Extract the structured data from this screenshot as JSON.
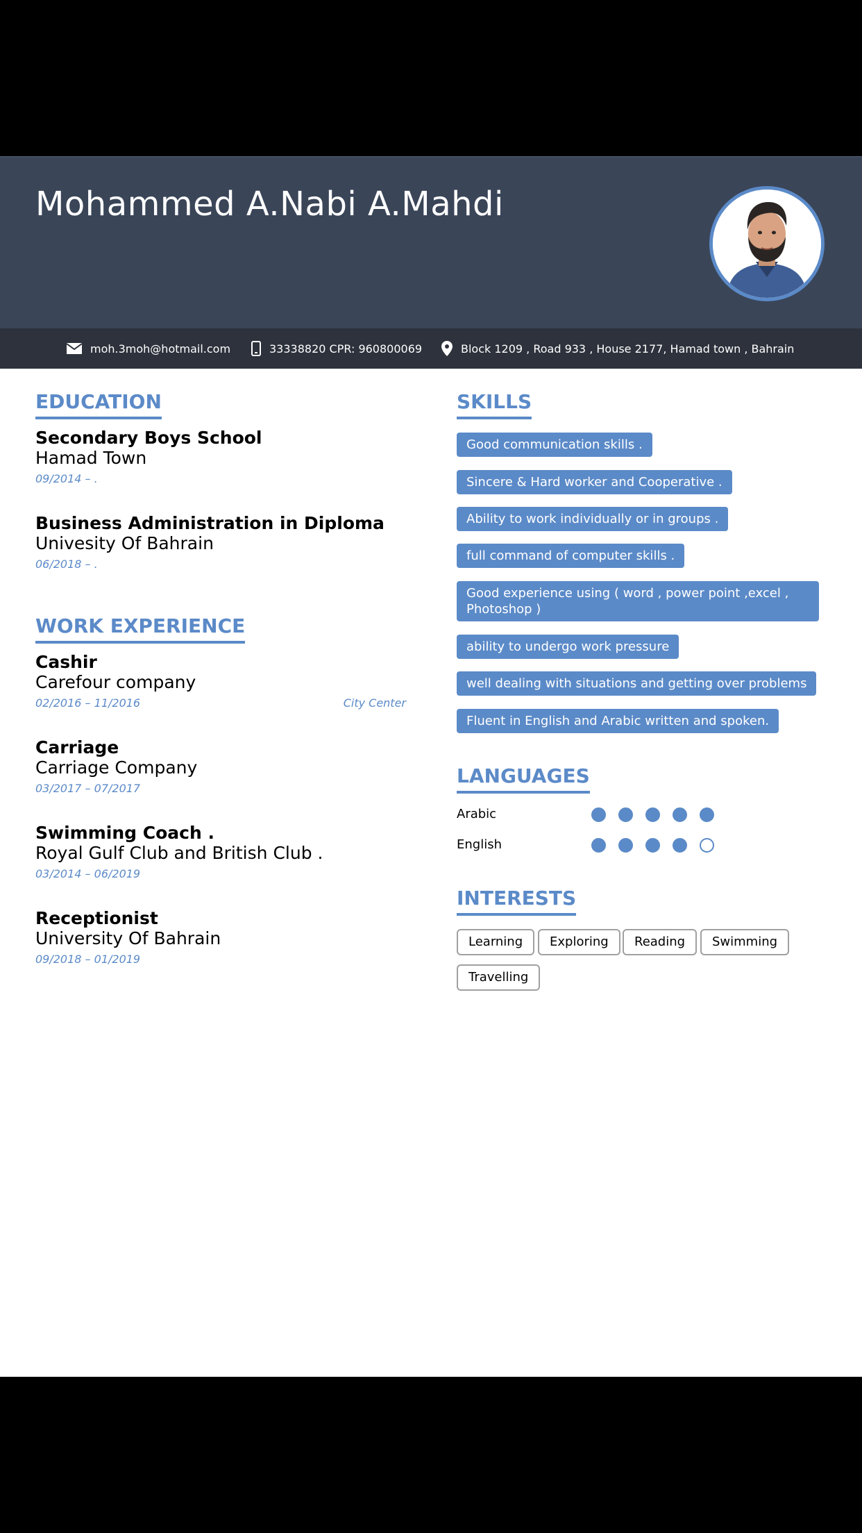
{
  "header": {
    "name": "Mohammed A.Nabi A.Mahdi",
    "accent_color": "#5b8ac8",
    "header_color": "#3a4558"
  },
  "contact": {
    "email": "moh.3moh@hotmail.com",
    "phone": "33338820 CPR: 960800069",
    "address": "Block 1209 , Road 933 , House 2177, Hamad town , Bahrain",
    "icons": [
      "envelope-icon",
      "phone-icon",
      "location-pin-icon"
    ]
  },
  "education": {
    "title": "EDUCATION",
    "items": [
      {
        "title": "Secondary Boys School",
        "sub": "Hamad Town",
        "date": "09/2014 – ."
      },
      {
        "title": "Business Administration in Diploma",
        "sub": "Univesity Of Bahrain",
        "date": "06/2018 – ."
      }
    ]
  },
  "work": {
    "title": "WORK EXPERIENCE",
    "items": [
      {
        "title": "Cashir",
        "sub": "Carefour company",
        "date": "02/2016 – 11/2016",
        "location": "City Center"
      },
      {
        "title": "Carriage",
        "sub": "Carriage Company",
        "date": "03/2017 – 07/2017"
      },
      {
        "title": "Swimming Coach .",
        "sub": "Royal Gulf Club and British Club .",
        "date": "03/2014 – 06/2019"
      },
      {
        "title": "Receptionist",
        "sub": "University Of Bahrain",
        "date": "09/2018 – 01/2019"
      }
    ]
  },
  "skills": {
    "title": "SKILLS",
    "items": [
      "Good communication skills .",
      "Sincere & Hard worker and Cooperative .",
      "Ability to work individually or in groups .",
      "full command of computer skills .",
      "Good experience using ( word , power point ,excel , Photoshop )",
      "ability to undergo work pressure",
      "well dealing with situations and getting over problems",
      "Fluent in English and Arabic written and spoken."
    ]
  },
  "languages": {
    "title": "LANGUAGES",
    "items": [
      {
        "name": "Arabic",
        "level": 5,
        "max": 5
      },
      {
        "name": "English",
        "level": 4,
        "max": 5
      }
    ]
  },
  "interests": {
    "title": "INTERESTS",
    "items": [
      "Learning",
      "Exploring",
      "Reading",
      "Swimming",
      "Travelling"
    ]
  }
}
